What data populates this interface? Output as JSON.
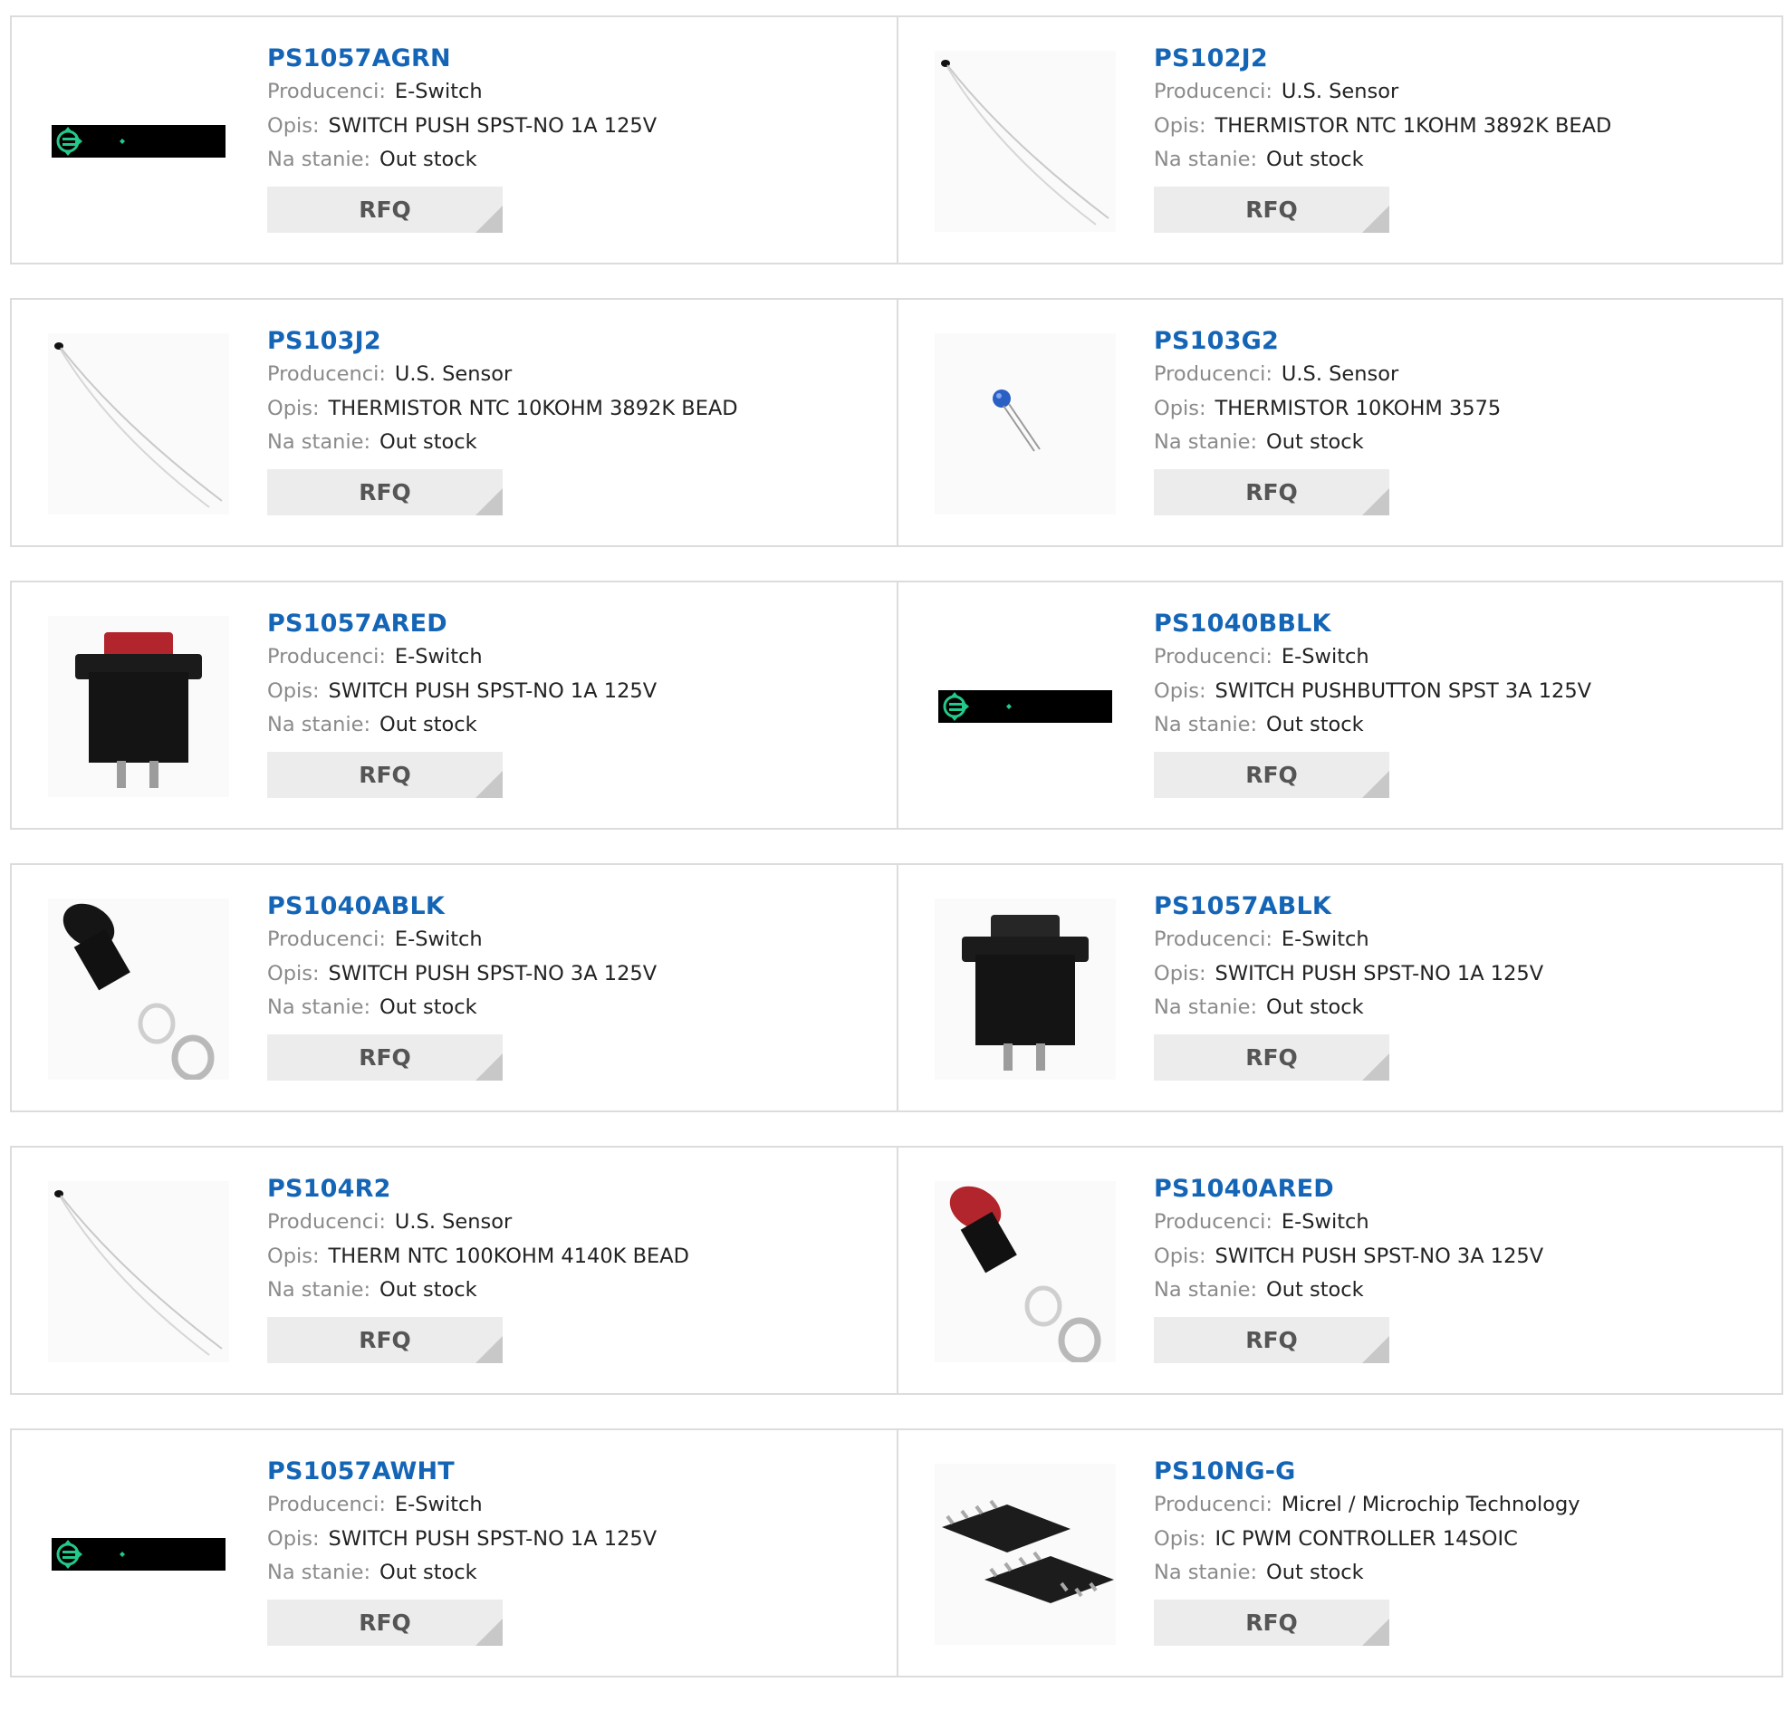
{
  "labels": {
    "manufacturer": "Producenci:",
    "description": "Opis:",
    "stock": "Na stanie:",
    "rfq": "RFQ"
  },
  "colors": {
    "part_link": "#1565b6",
    "label": "#8a8a8a",
    "value": "#222222",
    "rfq_bg": "#ececec",
    "rfq_corner": "#c8c8c8",
    "border": "#dcdcdc"
  },
  "products": [
    {
      "part": "PS1057AGRN",
      "manufacturer": "E-Switch",
      "description": "SWITCH PUSH SPST-NO 1A 125V",
      "stock": "Out stock",
      "image": "loading-placeholder-icon"
    },
    {
      "part": "PS102J2",
      "manufacturer": "U.S. Sensor",
      "description": "THERMISTOR NTC 1KOHM 3892K BEAD",
      "stock": "Out stock",
      "image": "thermistor-bead-icon"
    },
    {
      "part": "PS103J2",
      "manufacturer": "U.S. Sensor",
      "description": "THERMISTOR NTC 10KOHM 3892K BEAD",
      "stock": "Out stock",
      "image": "thermistor-bead-icon"
    },
    {
      "part": "PS103G2",
      "manufacturer": "U.S. Sensor",
      "description": "THERMISTOR 10KOHM 3575",
      "stock": "Out stock",
      "image": "thermistor-disc-icon"
    },
    {
      "part": "PS1057ARED",
      "manufacturer": "E-Switch",
      "description": "SWITCH PUSH SPST-NO 1A 125V",
      "stock": "Out stock",
      "image": "square-pushbutton-red-icon"
    },
    {
      "part": "PS1040BBLK",
      "manufacturer": "E-Switch",
      "description": "SWITCH PUSHBUTTON SPST 3A 125V",
      "stock": "Out stock",
      "image": "loading-placeholder-icon"
    },
    {
      "part": "PS1040ABLK",
      "manufacturer": "E-Switch",
      "description": "SWITCH PUSH SPST-NO 3A 125V",
      "stock": "Out stock",
      "image": "round-pushbutton-black-icon"
    },
    {
      "part": "PS1057ABLK",
      "manufacturer": "E-Switch",
      "description": "SWITCH PUSH SPST-NO 1A 125V",
      "stock": "Out stock",
      "image": "square-pushbutton-black-icon"
    },
    {
      "part": "PS104R2",
      "manufacturer": "U.S. Sensor",
      "description": "THERM NTC 100KOHM 4140K BEAD",
      "stock": "Out stock",
      "image": "thermistor-bead-icon"
    },
    {
      "part": "PS1040ARED",
      "manufacturer": "E-Switch",
      "description": "SWITCH PUSH SPST-NO 3A 125V",
      "stock": "Out stock",
      "image": "round-pushbutton-red-icon"
    },
    {
      "part": "PS1057AWHT",
      "manufacturer": "E-Switch",
      "description": "SWITCH PUSH SPST-NO 1A 125V",
      "stock": "Out stock",
      "image": "loading-placeholder-icon"
    },
    {
      "part": "PS10NG-G",
      "manufacturer": "Micrel / Microchip Technology",
      "description": "IC PWM CONTROLLER 14SOIC",
      "stock": "Out stock",
      "image": "soic-chip-icon"
    }
  ]
}
